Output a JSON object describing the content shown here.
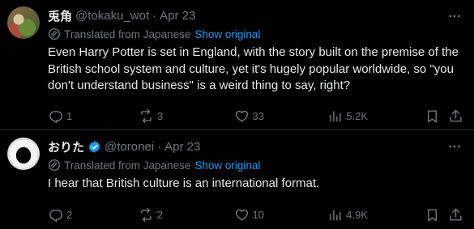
{
  "tweets": [
    {
      "name": "兎角",
      "handle": "@tokaku_wot",
      "date": "Apr 23",
      "verified": false,
      "translated_label": "Translated from Japanese",
      "show_original": "Show original",
      "text": "Even Harry Potter is set in England, with the story built on the premise of the British school system and culture, yet it's hugely popular worldwide, so \"you don't understand business\" is a weird thing to say, right?",
      "replies": "1",
      "reposts": "3",
      "likes": "33",
      "views": "5.2K"
    },
    {
      "name": "おりた",
      "handle": "@toronei",
      "date": "Apr 23",
      "verified": true,
      "translated_label": "Translated from Japanese",
      "show_original": "Show original",
      "text": "I hear that British culture is an international format.",
      "replies": "2",
      "reposts": "2",
      "likes": "10",
      "views": "4.9K"
    }
  ],
  "separator": "·",
  "colors": {
    "accent": "#1d9bf0",
    "muted": "#71767b",
    "text": "#e7e9ea",
    "border": "#2f3336"
  }
}
